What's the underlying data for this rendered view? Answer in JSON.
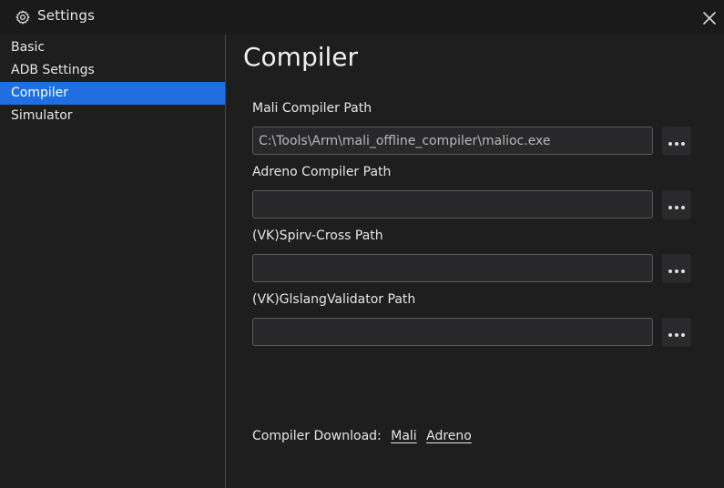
{
  "window": {
    "title": "Settings",
    "icon": "gear-icon",
    "close_icon": "close-icon"
  },
  "sidebar": {
    "items": [
      {
        "label": "Basic"
      },
      {
        "label": "ADB Settings"
      },
      {
        "label": "Compiler",
        "active": true
      },
      {
        "label": "Simulator"
      }
    ]
  },
  "main": {
    "heading": "Compiler",
    "fields": [
      {
        "label": "Mali Compiler Path",
        "value": "C:\\Tools\\Arm\\mali_offline_compiler\\malioc.exe"
      },
      {
        "label": "Adreno Compiler Path",
        "value": ""
      },
      {
        "label": "(VK)Spirv-Cross Path",
        "value": ""
      },
      {
        "label": "(VK)GlslangValidator Path",
        "value": ""
      }
    ],
    "browse_icon": "more-horizontal-icon",
    "download": {
      "label": "Compiler Download:",
      "links": [
        "Mali",
        "Adreno"
      ]
    }
  },
  "colors": {
    "accent": "#1f6fe0",
    "background": "#1e1e1f"
  }
}
